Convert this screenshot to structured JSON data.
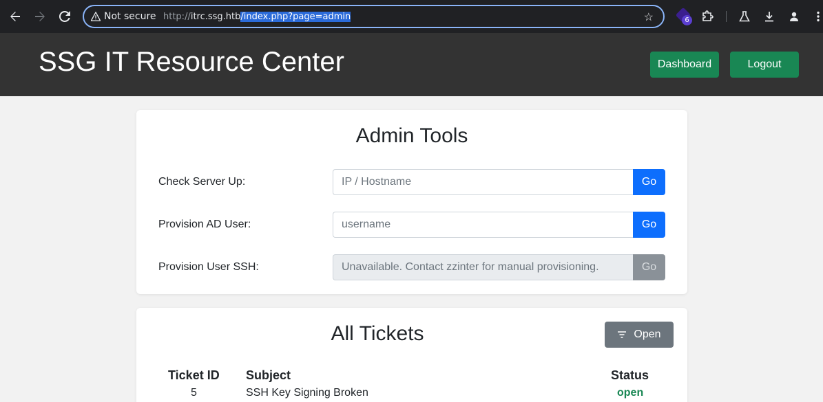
{
  "browser": {
    "security_label": "Not secure",
    "url_scheme": "http://",
    "url_host": "itrc.ssg.htb",
    "url_path": "/index.php?page=admin",
    "extension_badge": "6"
  },
  "header": {
    "title": "SSG IT Resource Center",
    "dashboard_label": "Dashboard",
    "logout_label": "Logout"
  },
  "admin_tools": {
    "title": "Admin Tools",
    "rows": [
      {
        "label": "Check Server Up:",
        "placeholder": "IP / Hostname",
        "button": "Go",
        "disabled": false
      },
      {
        "label": "Provision AD User:",
        "placeholder": "username",
        "button": "Go",
        "disabled": false
      },
      {
        "label": "Provision User SSH:",
        "placeholder": "Unavailable. Contact zzinter for manual provisioning.",
        "button": "Go",
        "disabled": true
      }
    ]
  },
  "tickets": {
    "title": "All Tickets",
    "filter_label": "Open",
    "columns": [
      "Ticket ID",
      "Subject",
      "Status"
    ],
    "rows": [
      {
        "id": "5",
        "subject": "SSH Key Signing Broken",
        "status": "open"
      }
    ]
  },
  "colors": {
    "header_bg": "#333333",
    "success": "#198754",
    "primary": "#0d6efd",
    "secondary": "#6c757d"
  }
}
